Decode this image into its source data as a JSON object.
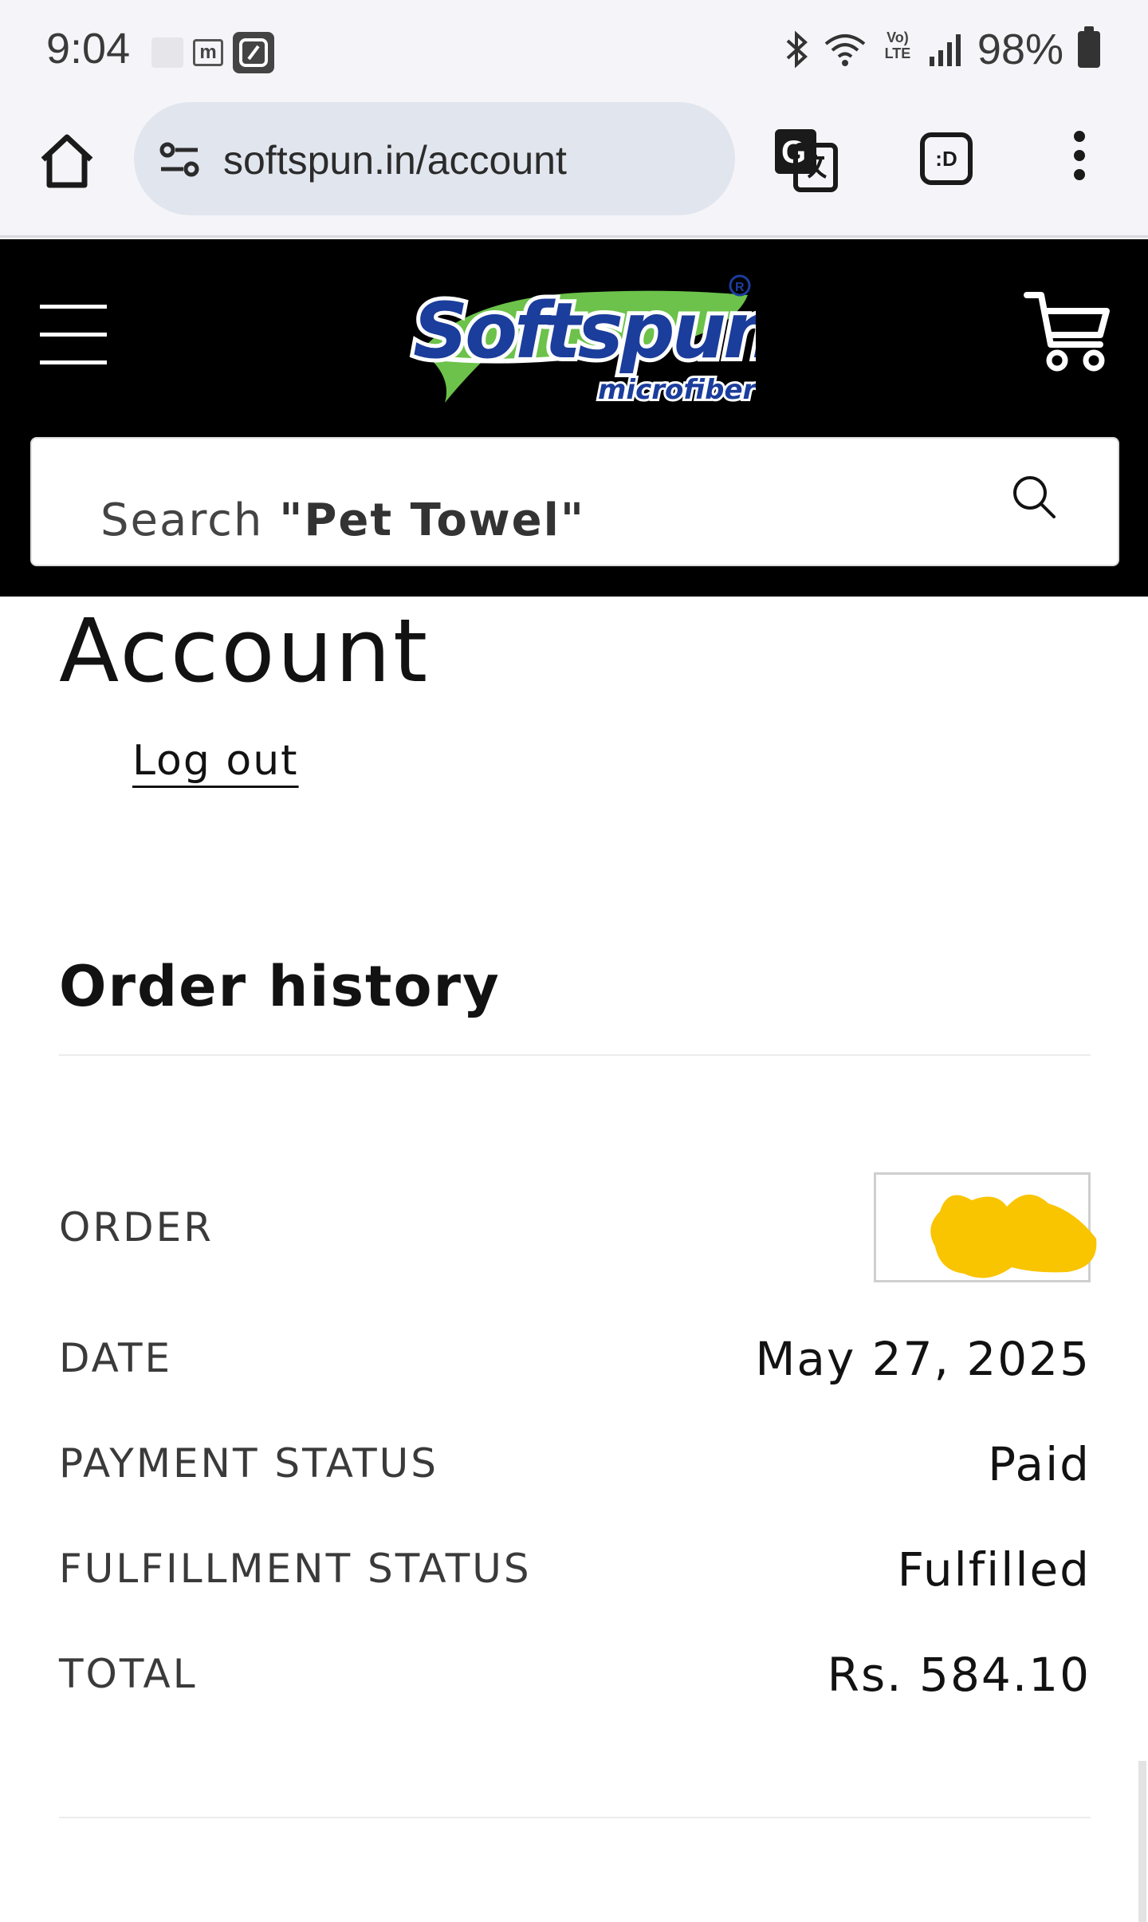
{
  "status_bar": {
    "time": "9:04",
    "lte_label": "Vo) LTE",
    "battery_percent": "98%",
    "notification_m": "m"
  },
  "browser": {
    "url": "softspun.in/account",
    "tabs_label": ":D"
  },
  "header": {
    "logo_alt": "Softspun microfiber",
    "search": {
      "placeholder_prefix": "Search ",
      "placeholder_term": "\"Pet Towel\""
    }
  },
  "account": {
    "title": "Account",
    "logout_label": "Log out"
  },
  "order_history": {
    "title": "Order history",
    "rows": {
      "order": {
        "label": "ORDER",
        "value": ""
      },
      "date": {
        "label": "DATE",
        "value": "May 27, 2025"
      },
      "payment": {
        "label": "PAYMENT STATUS",
        "value": "Paid"
      },
      "fulfillment": {
        "label": "FULFILLMENT STATUS",
        "value": "Fulfilled"
      },
      "total": {
        "label": "TOTAL",
        "value": "Rs. 584.10"
      }
    }
  },
  "colors": {
    "header_bg": "#000000",
    "browser_bg": "#f5f5f9",
    "url_pill": "#e1e5ee",
    "redaction": "#f9c400",
    "text": "#121212"
  }
}
